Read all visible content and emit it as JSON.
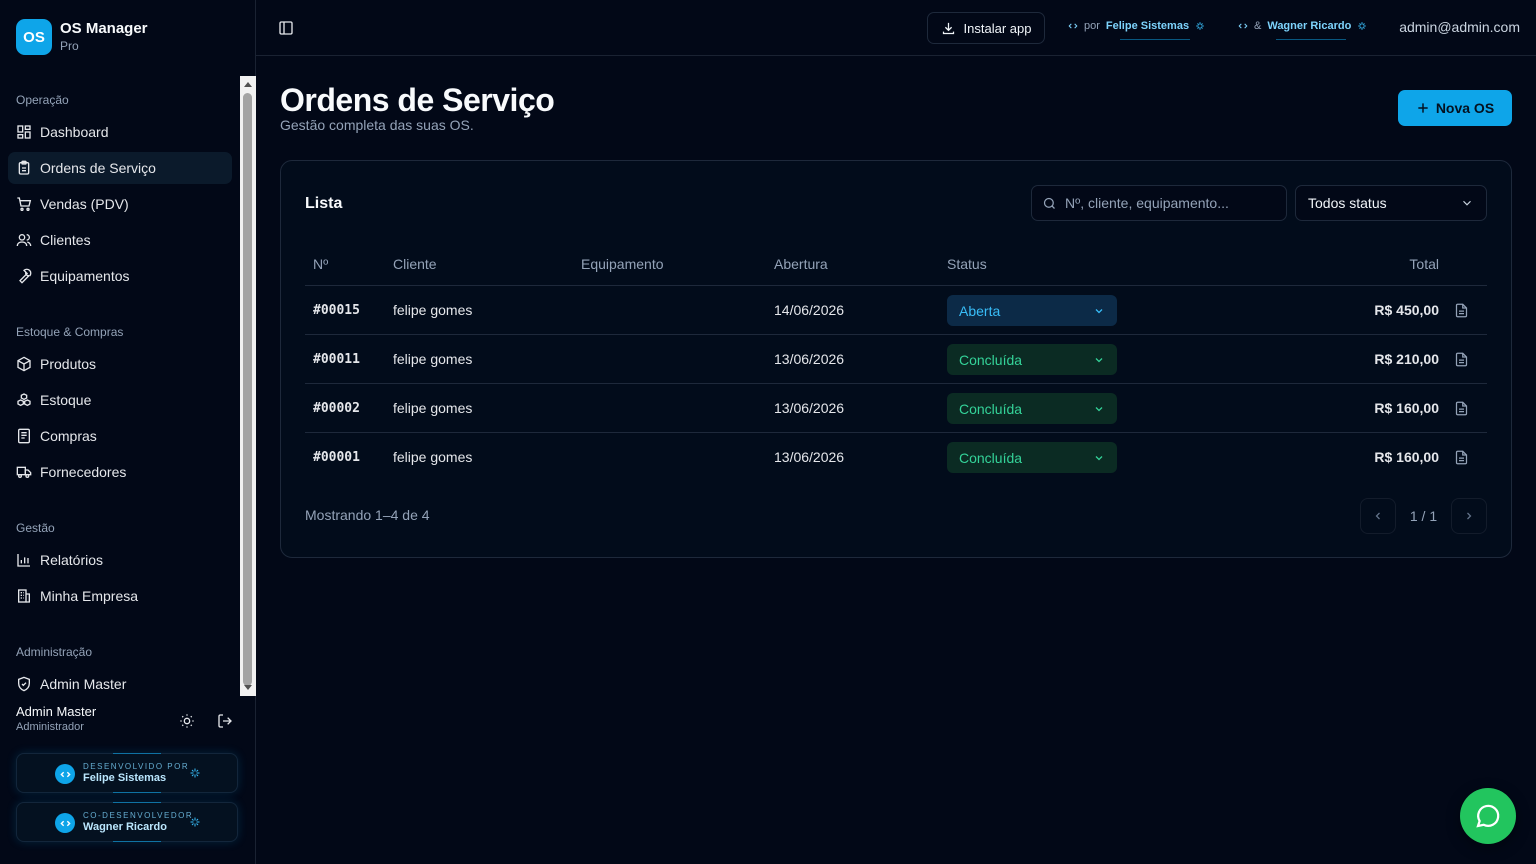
{
  "brand": {
    "logo": "OS",
    "name": "OS Manager",
    "plan": "Pro"
  },
  "sidebar": {
    "groups": [
      {
        "label": "Operação",
        "items": [
          {
            "label": "Dashboard",
            "icon": "dashboard-icon"
          },
          {
            "label": "Ordens de Serviço",
            "icon": "clipboard-icon",
            "active": true
          },
          {
            "label": "Vendas (PDV)",
            "icon": "cart-icon"
          },
          {
            "label": "Clientes",
            "icon": "users-icon"
          },
          {
            "label": "Equipamentos",
            "icon": "wrench-icon"
          }
        ]
      },
      {
        "label": "Estoque & Compras",
        "items": [
          {
            "label": "Produtos",
            "icon": "package-icon"
          },
          {
            "label": "Estoque",
            "icon": "boxes-icon"
          },
          {
            "label": "Compras",
            "icon": "receipt-icon"
          },
          {
            "label": "Fornecedores",
            "icon": "truck-icon"
          }
        ]
      },
      {
        "label": "Gestão",
        "items": [
          {
            "label": "Relatórios",
            "icon": "bar-chart-icon"
          },
          {
            "label": "Minha Empresa",
            "icon": "building-icon"
          }
        ]
      },
      {
        "label": "Administração",
        "items": [
          {
            "label": "Admin Master",
            "icon": "shield-icon"
          }
        ]
      }
    ],
    "user": {
      "name": "Admin Master",
      "role": "Administrador"
    },
    "dev_cards": [
      {
        "label": "DESENVOLVIDO POR",
        "name": "Felipe Sistemas"
      },
      {
        "label": "CO-DESENVOLVEDOR",
        "name": "Wagner Ricardo"
      }
    ]
  },
  "topbar": {
    "install_label": "Instalar app",
    "credit1_prefix": "por",
    "credit1_name": "Felipe Sistemas",
    "credit2_prefix": "&",
    "credit2_name": "Wagner Ricardo",
    "email": "admin@admin.com"
  },
  "page": {
    "title": "Ordens de Serviço",
    "subtitle": "Gestão completa das suas OS.",
    "new_button": "Nova OS"
  },
  "list": {
    "title": "Lista",
    "search_placeholder": "Nº, cliente, equipamento...",
    "status_filter": "Todos status",
    "columns": {
      "num": "Nº",
      "client": "Cliente",
      "equipment": "Equipamento",
      "opened": "Abertura",
      "status": "Status",
      "total": "Total"
    },
    "rows": [
      {
        "num": "#00015",
        "client": "felipe gomes",
        "equipment": "",
        "opened": "14/06/2026",
        "status": "Aberta",
        "status_kind": "aberta",
        "total": "R$ 450,00"
      },
      {
        "num": "#00011",
        "client": "felipe gomes",
        "equipment": "",
        "opened": "13/06/2026",
        "status": "Concluída",
        "status_kind": "concluida",
        "total": "R$ 210,00"
      },
      {
        "num": "#00002",
        "client": "felipe gomes",
        "equipment": "",
        "opened": "13/06/2026",
        "status": "Concluída",
        "status_kind": "concluida",
        "total": "R$ 160,00"
      },
      {
        "num": "#00001",
        "client": "felipe gomes",
        "equipment": "",
        "opened": "13/06/2026",
        "status": "Concluída",
        "status_kind": "concluida",
        "total": "R$ 160,00"
      }
    ],
    "showing": "Mostrando 1–4 de 4",
    "page_info": "1 / 1"
  },
  "colors": {
    "accent": "#0ea5e9",
    "background": "#020817",
    "open": "#38bdf8",
    "done": "#34d399",
    "whatsapp": "#22c55e"
  }
}
